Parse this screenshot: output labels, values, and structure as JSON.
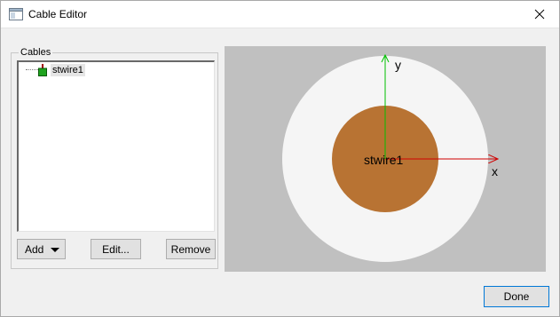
{
  "window": {
    "title": "Cable Editor",
    "close_glyph": "✕"
  },
  "cables": {
    "group_label": "Cables",
    "items": [
      {
        "label": "stwire1",
        "icon": "cable-node-icon"
      }
    ],
    "add_label": "Add",
    "edit_label": "Edit...",
    "remove_label": "Remove"
  },
  "preview": {
    "wire_label": "stwire1",
    "x_axis_label": "x",
    "y_axis_label": "y",
    "colors": {
      "background": "#c0c0c0",
      "insulation": "#f5f5f5",
      "conductor": "#b87333",
      "x_axis": "#d00000",
      "y_axis": "#00c000"
    }
  },
  "footer": {
    "done_label": "Done"
  }
}
